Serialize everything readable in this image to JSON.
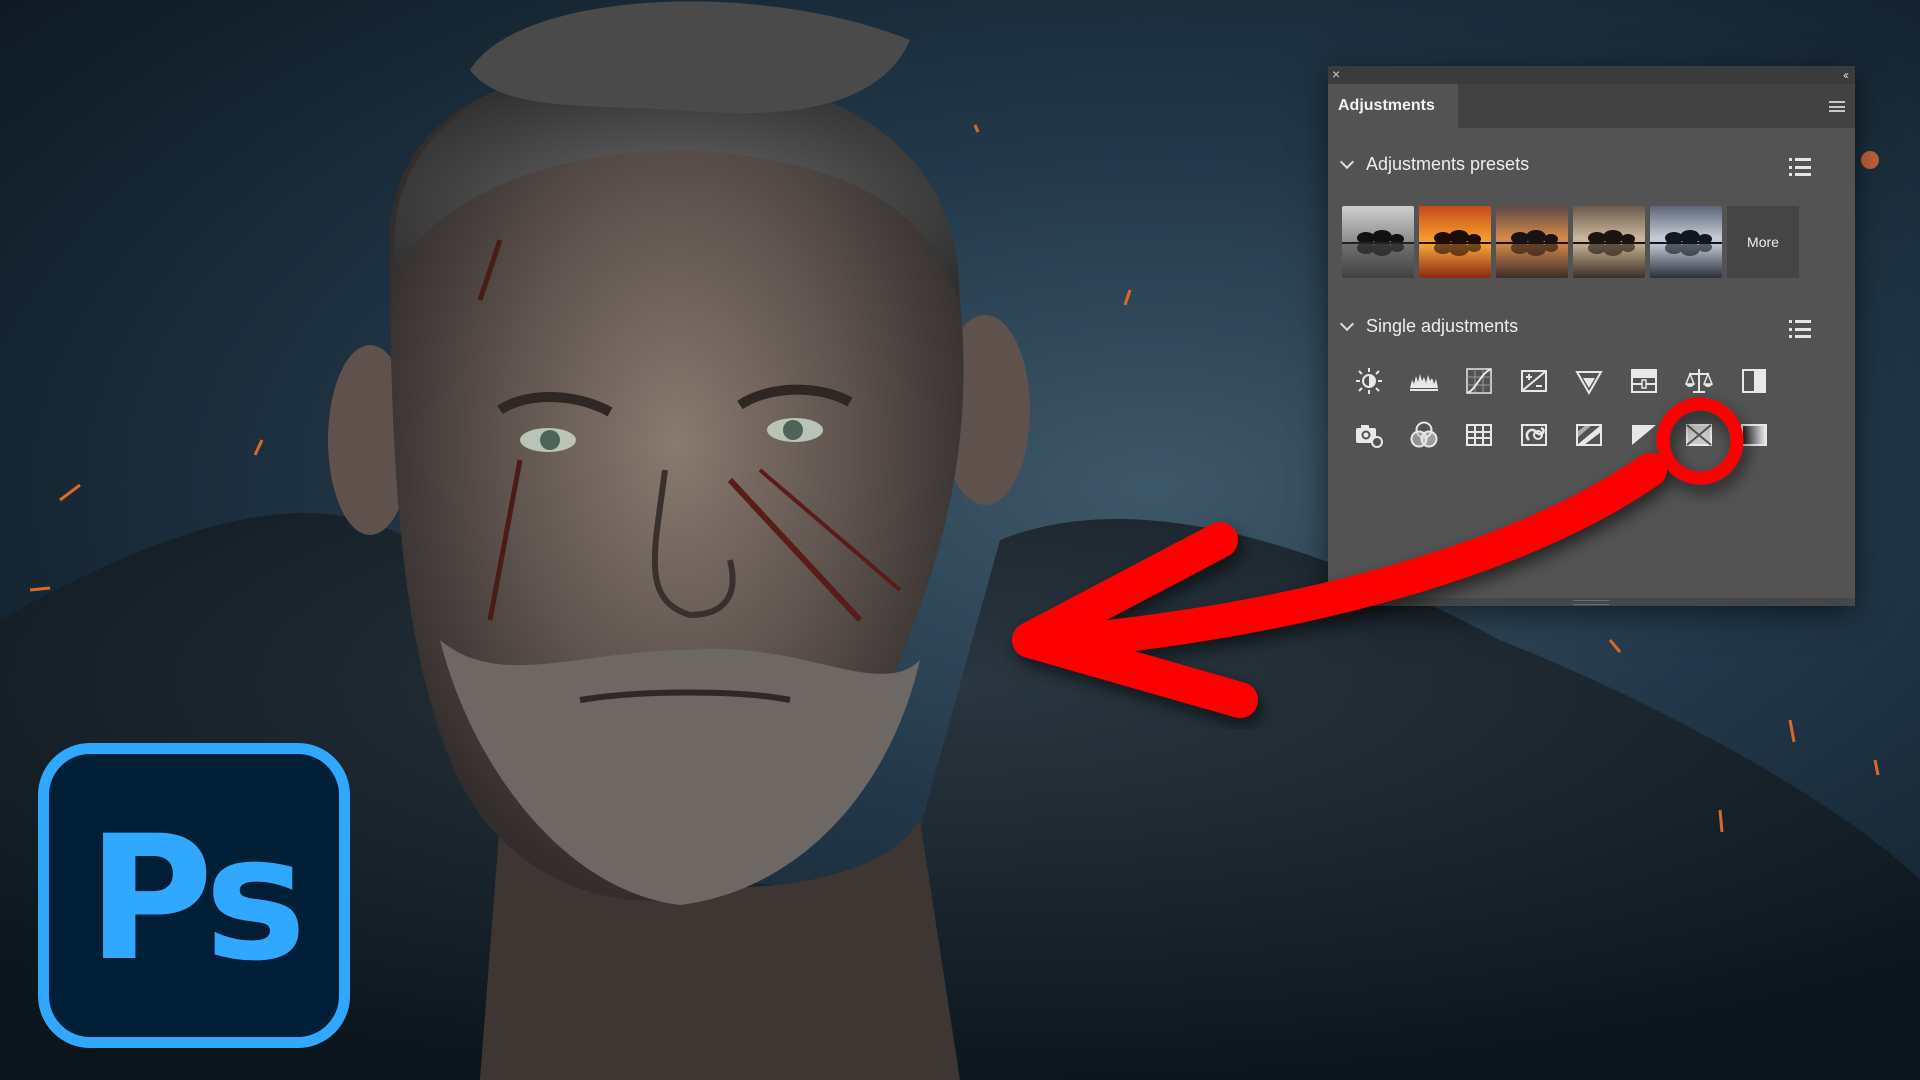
{
  "panel": {
    "close_glyph": "×",
    "collapse_glyph": "‹‹",
    "tab_label": "Adjustments",
    "presets_section": {
      "title": "Adjustments presets",
      "more_label": "More",
      "thumbnails": [
        "b&w-tree-preset",
        "sunset-orange-preset",
        "warm-dusk-preset",
        "sepia-preset",
        "cool-blue-preset"
      ]
    },
    "single_section": {
      "title": "Single adjustments",
      "icons_row1": [
        "brightness-contrast-icon",
        "levels-icon",
        "curves-icon",
        "exposure-icon",
        "vibrance-icon",
        "hue-saturation-icon",
        "color-balance-icon",
        "black-white-icon"
      ],
      "icons_row2": [
        "photo-filter-icon",
        "channel-mixer-icon",
        "color-lookup-icon",
        "invert-icon",
        "posterize-icon",
        "threshold-icon",
        "selective-color-icon",
        "gradient-map-icon"
      ]
    }
  },
  "logo": {
    "text": "Ps",
    "colors": {
      "fill": "#001e36",
      "accent": "#31a8ff"
    }
  },
  "annotation": {
    "color": "#ff0000",
    "highlighted_item": "selective-color-icon"
  }
}
